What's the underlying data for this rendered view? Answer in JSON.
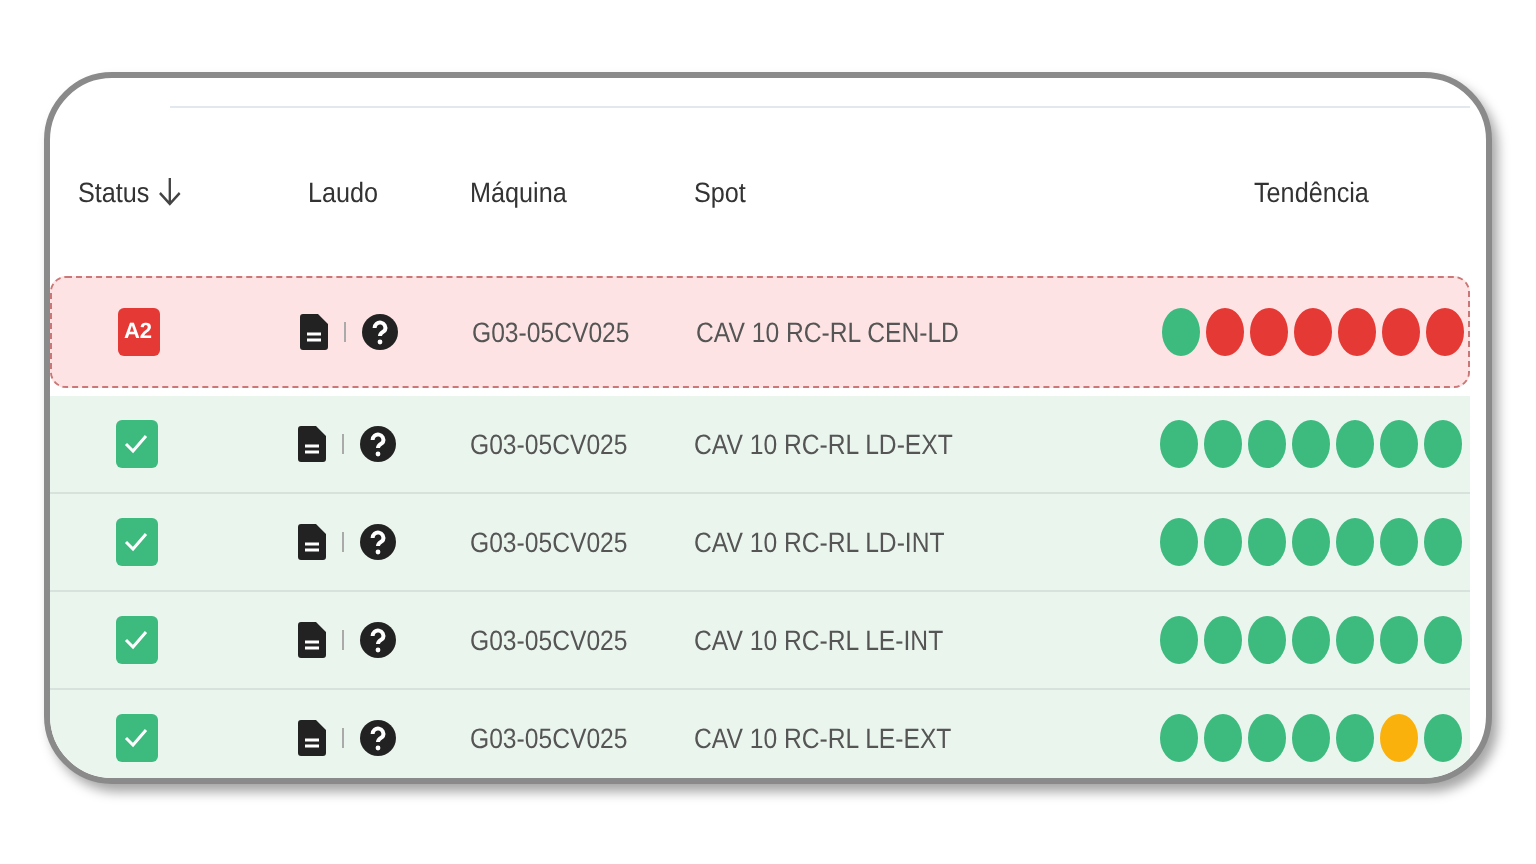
{
  "table": {
    "columns": [
      {
        "label": "Status",
        "sorted_descending": true
      },
      {
        "label": "Laudo"
      },
      {
        "label": "Máquina"
      },
      {
        "label": "Spot"
      },
      {
        "label": "Tendência"
      }
    ],
    "rows": [
      {
        "status": {
          "kind": "alert",
          "text": "A2"
        },
        "selected": true,
        "machine": "G03-05CV025",
        "spot": "CAV 10 RC-RL CEN-LD",
        "trend": [
          {
            "color": "#3dba7e"
          },
          {
            "color": "#e53935"
          },
          {
            "color": "#e53935"
          },
          {
            "color": "#e53935"
          },
          {
            "color": "#e53935"
          },
          {
            "color": "#e53935"
          },
          {
            "color": "#e53935"
          }
        ]
      },
      {
        "status": {
          "kind": "ok"
        },
        "selected": false,
        "machine": "G03-05CV025",
        "spot": "CAV 10 RC-RL LD-EXT",
        "trend": [
          {
            "color": "#3dba7e"
          },
          {
            "color": "#3dba7e"
          },
          {
            "color": "#3dba7e"
          },
          {
            "color": "#3dba7e"
          },
          {
            "color": "#3dba7e"
          },
          {
            "color": "#3dba7e"
          },
          {
            "color": "#3dba7e"
          }
        ]
      },
      {
        "status": {
          "kind": "ok"
        },
        "selected": false,
        "machine": "G03-05CV025",
        "spot": "CAV 10 RC-RL LD-INT",
        "trend": [
          {
            "color": "#3dba7e"
          },
          {
            "color": "#3dba7e"
          },
          {
            "color": "#3dba7e"
          },
          {
            "color": "#3dba7e"
          },
          {
            "color": "#3dba7e"
          },
          {
            "color": "#3dba7e"
          },
          {
            "color": "#3dba7e"
          }
        ]
      },
      {
        "status": {
          "kind": "ok"
        },
        "selected": false,
        "machine": "G03-05CV025",
        "spot": "CAV 10 RC-RL LE-INT",
        "trend": [
          {
            "color": "#3dba7e"
          },
          {
            "color": "#3dba7e"
          },
          {
            "color": "#3dba7e"
          },
          {
            "color": "#3dba7e"
          },
          {
            "color": "#3dba7e"
          },
          {
            "color": "#3dba7e"
          },
          {
            "color": "#3dba7e"
          }
        ]
      },
      {
        "status": {
          "kind": "ok"
        },
        "selected": false,
        "machine": "G03-05CV025",
        "spot": "CAV 10 RC-RL LE-EXT",
        "trend": [
          {
            "color": "#3dba7e"
          },
          {
            "color": "#3dba7e"
          },
          {
            "color": "#3dba7e"
          },
          {
            "color": "#3dba7e"
          },
          {
            "color": "#3dba7e"
          },
          {
            "color": "#fbb10c"
          },
          {
            "color": "#3dba7e"
          }
        ]
      }
    ]
  }
}
